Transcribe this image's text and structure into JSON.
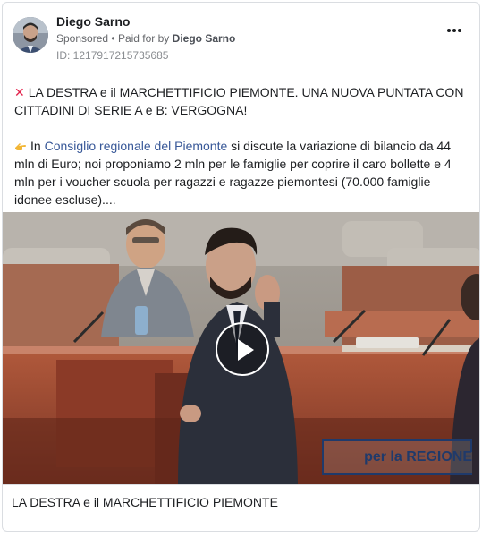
{
  "post": {
    "author": "Diego Sarno",
    "sponsored_label": "Sponsored",
    "paid_for_label": "Paid for by",
    "paid_for_name": "Diego Sarno",
    "ad_id": "ID: 1217917215735685",
    "text_line1": "LA DESTRA e il MARCHETTIFICIO PIEMONTE. UNA NUOVA PUNTATA CON CITTADINI DI SERIE A e B: VERGOGNA!",
    "text_line2_prefix": "In",
    "text_line2_link": "Consiglio regionale del Piemonte",
    "text_line2_rest": "si discute la variazione di bilancio da 44 mln di Euro; noi proponiamo 2 mln per le famiglie per coprire il caro bollette e 4 mln per i voucher scuola per ragazzi e ragazze piemontesi (70.000 famiglie idonee escluse)....",
    "video_overlay_text": "per la REGIONE",
    "video_caption": "LA DESTRA e il MARCHETTIFICIO PIEMONTE"
  },
  "icons": {
    "x_icon": "cross-mark-icon",
    "hand_icon": "pointing-hand-icon",
    "more_icon": "more-options-icon",
    "play_icon": "play-icon"
  },
  "colors": {
    "link": "#385898",
    "x_icon": "#e2224b",
    "overlay_logo": "#1f3a6b"
  }
}
